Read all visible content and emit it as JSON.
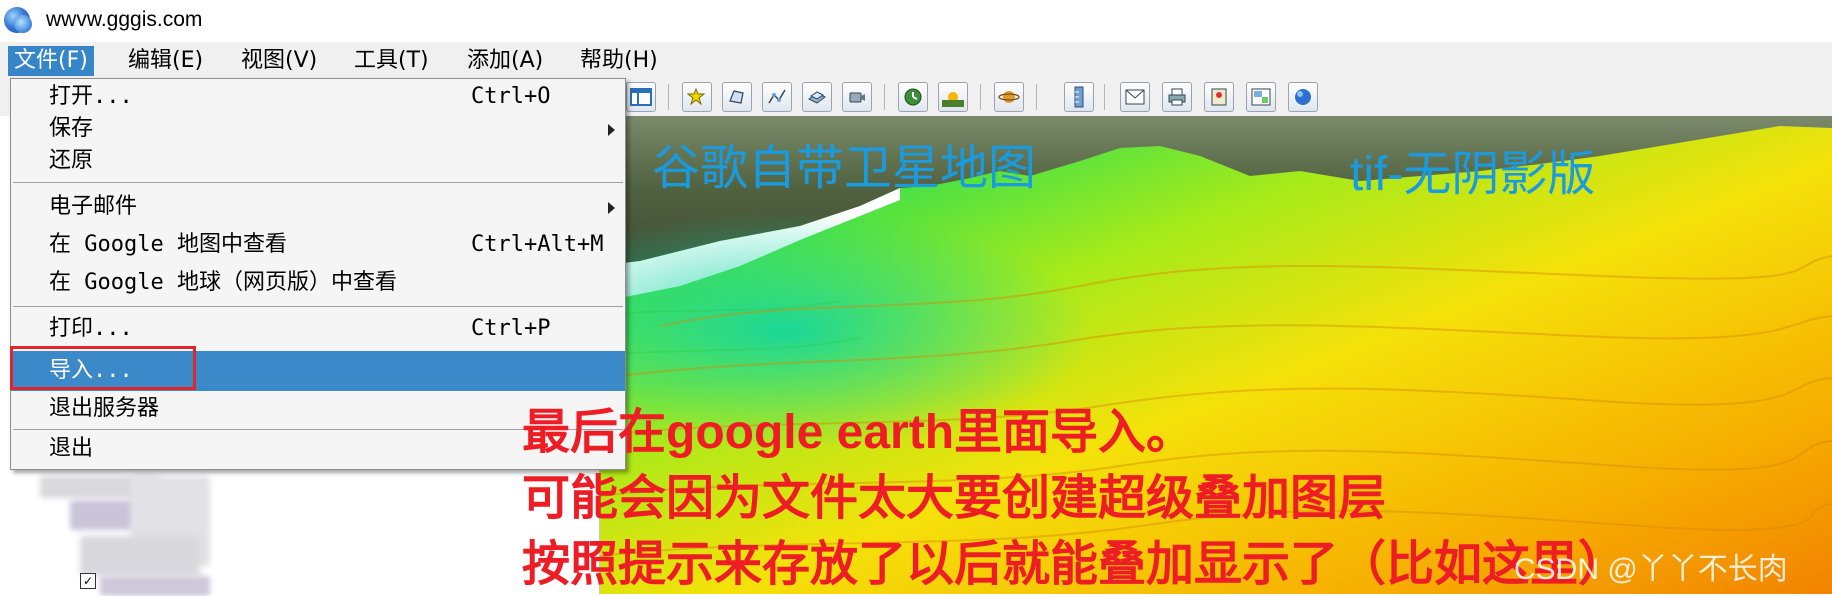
{
  "window": {
    "title": "wwvw.gggis.com"
  },
  "menubar": [
    {
      "label": "文件(F)"
    },
    {
      "label": "编辑(E)"
    },
    {
      "label": "视图(V)"
    },
    {
      "label": "工具(T)"
    },
    {
      "label": "添加(A)"
    },
    {
      "label": "帮助(H)"
    }
  ],
  "file_menu": {
    "items": [
      {
        "label": "打开...",
        "shortcut": "Ctrl+O"
      },
      {
        "label": "保存",
        "submenu": true
      },
      {
        "label": "还原"
      },
      {
        "label": "电子邮件",
        "submenu": true
      },
      {
        "label": "在 Google 地图中查看",
        "shortcut": "Ctrl+Alt+M"
      },
      {
        "label": "在 Google 地球（网页版）中查看"
      },
      {
        "label": "打印...",
        "shortcut": "Ctrl+P"
      },
      {
        "label": "导入...",
        "selected": true
      },
      {
        "label": "退出服务器"
      },
      {
        "label": "退出"
      }
    ]
  },
  "toolbar": {
    "icons": [
      "layout-icon",
      "add-placemark-icon",
      "add-polygon-icon",
      "add-path-icon",
      "add-image-overlay-icon",
      "record-tour-icon",
      "historical-imagery-icon",
      "sunlight-icon",
      "planets-icon",
      "ruler-icon",
      "email-icon",
      "print-icon",
      "view-in-google-maps-icon",
      "save-image-icon",
      "earth-icon"
    ]
  },
  "annotations": {
    "left_label": "谷歌自带卫星地图",
    "right_label": "tif-无阴影版",
    "instruction_line1": "最后在google earth里面导入。",
    "instruction_line2": "可能会因为文件太大要创建超级叠加图层",
    "instruction_line3": "按照提示来存放了以后就能叠加显示了（比如这里）",
    "watermark": "CSDN @丫丫不长肉"
  },
  "colors": {
    "menu_highlight": "#3b89c9",
    "annotation_red": "#ee1c24",
    "annotation_blue": "#1a9be0",
    "highlight_box": "#e0262b"
  }
}
